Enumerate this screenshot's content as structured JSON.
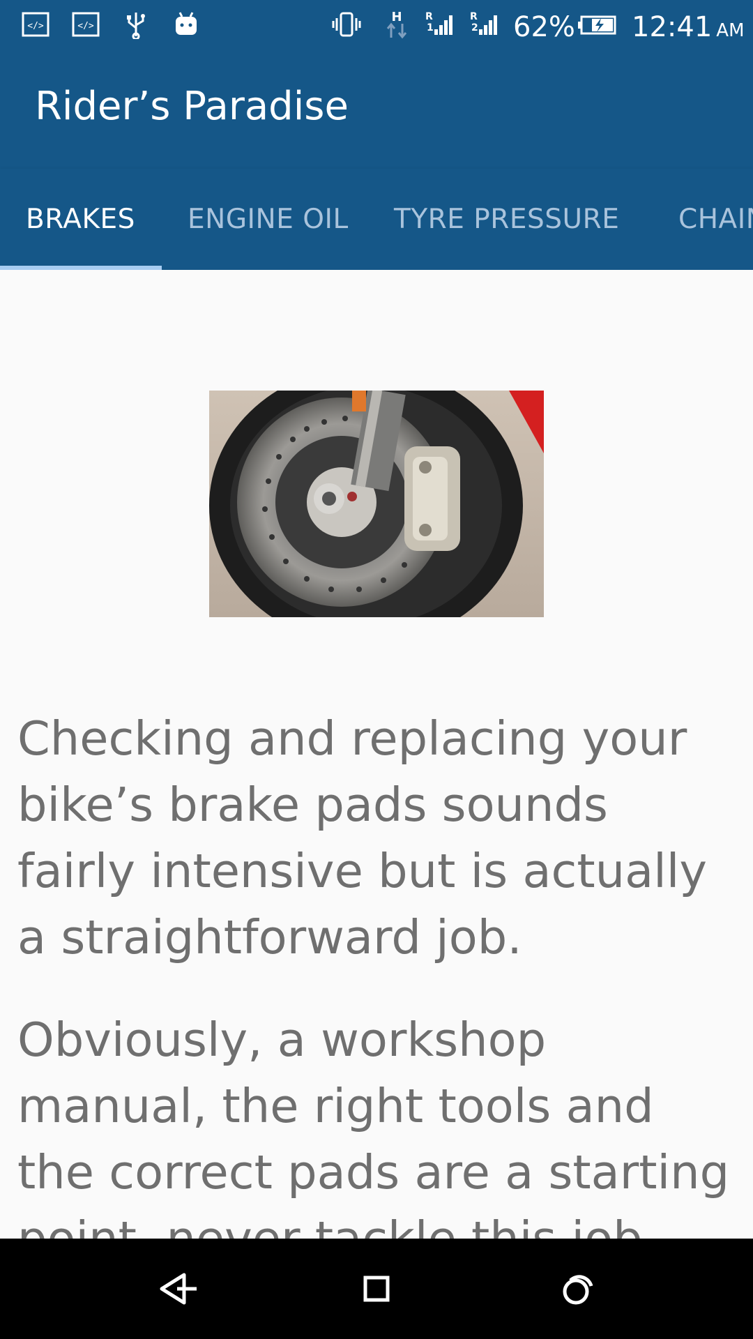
{
  "status_bar": {
    "battery_percent": "62%",
    "time": "12:41",
    "ampm": "AM",
    "network_type": "H",
    "sim1_label": "R1",
    "sim2_label": "R2"
  },
  "app_bar": {
    "title": "Rider’s Paradise"
  },
  "tabs": [
    {
      "label": "BRAKES",
      "active": true
    },
    {
      "label": "ENGINE OIL",
      "active": false
    },
    {
      "label": "TYRE PRESSURE",
      "active": false
    },
    {
      "label": "CHAIN",
      "active": false
    }
  ],
  "content": {
    "image_subject": "motorcycle front brake disc and caliper",
    "paragraphs": [
      "Checking and replacing your bike’s brake pads sounds fairly intensive but is actually a straightforward job.",
      "Obviously, a workshop manual, the right tools and the correct pads are a starting point. never tackle this job unless"
    ]
  },
  "colors": {
    "primary": "#155788",
    "tab_inactive": "#a9c3dc",
    "indicator": "#a7cdf2",
    "body_text": "#6f6f6f",
    "background": "#fafafa"
  },
  "nav_icons": [
    "back-icon",
    "home-icon",
    "recents-icon"
  ]
}
